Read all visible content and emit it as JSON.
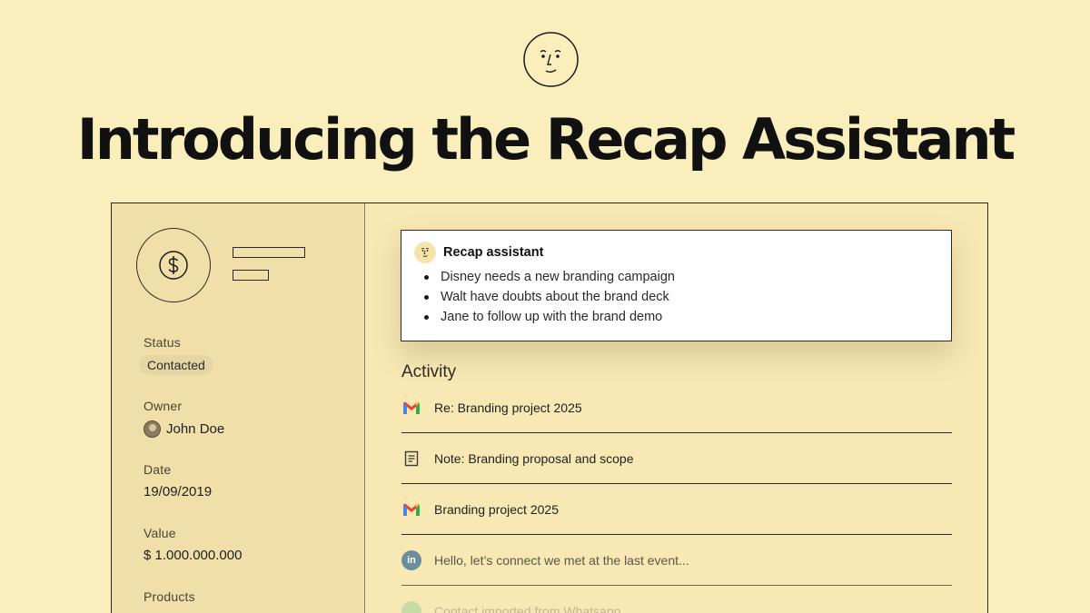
{
  "headline": "Introducing the Recap Assistant",
  "icons": {
    "logo": "face-icon",
    "company": "dollar-icon",
    "recap": "face-icon",
    "gmail": "gmail-icon",
    "note": "note-icon",
    "linkedin": "linkedin-icon",
    "whatsapp": "whatsapp-icon"
  },
  "sidebar": {
    "status": {
      "label": "Status",
      "value": "Contacted"
    },
    "owner": {
      "label": "Owner",
      "value": "John Doe"
    },
    "date": {
      "label": "Date",
      "value": "19/09/2019"
    },
    "value": {
      "label": "Value",
      "value": "$ 1.000.000.000"
    },
    "products": {
      "label": "Products"
    }
  },
  "recap": {
    "title": "Recap assistant",
    "items": [
      "Disney needs a new branding campaign",
      "Walt have doubts about the brand deck",
      "Jane to follow up with the brand demo"
    ]
  },
  "activity": {
    "title": "Activity",
    "items": [
      {
        "text": "Re: Branding project 2025"
      },
      {
        "text": "Note: Branding proposal and scope"
      },
      {
        "text": "Branding project 2025"
      },
      {
        "text": "Hello, let’s connect we met at the last event..."
      },
      {
        "text": "Contact imported from Whatsapp"
      }
    ]
  },
  "colors": {
    "background": "#fbeebd",
    "sidebar": "#f1dfa9",
    "card": "#ffffff",
    "linkedin": "#6c8e9c",
    "whatsapp": "#6fc58a"
  }
}
